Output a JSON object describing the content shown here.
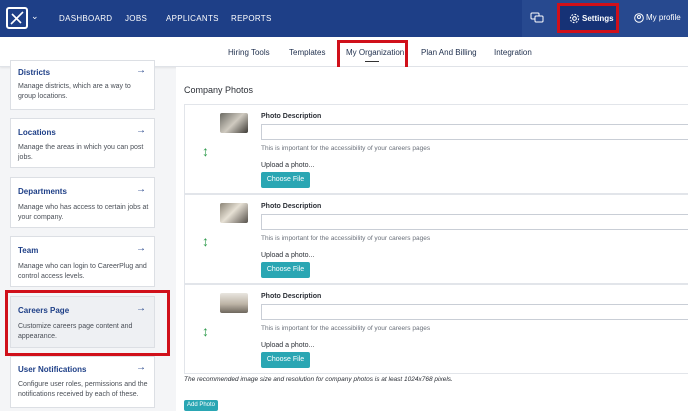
{
  "top_nav": {
    "items": [
      "DASHBOARD",
      "JOBS",
      "APPLICANTS",
      "REPORTS"
    ],
    "settings_label": "Settings",
    "profile_label": "My profile"
  },
  "sub_nav": {
    "items": [
      "Hiring Tools",
      "Templates",
      "My Organization",
      "Plan And Billing",
      "Integration"
    ],
    "active": "My Organization"
  },
  "sidebar": {
    "cards": [
      {
        "title": "Districts",
        "desc": "Manage districts, which are a way to group locations."
      },
      {
        "title": "Locations",
        "desc": "Manage the areas in which you can post jobs."
      },
      {
        "title": "Departments",
        "desc": "Manage who has access to certain jobs at your company."
      },
      {
        "title": "Team",
        "desc": "Manage who can login to CareerPlug and control access levels."
      },
      {
        "title": "Careers Page",
        "desc": "Customize careers page content and appearance."
      },
      {
        "title": "User Notifications",
        "desc": "Configure user roles, permissions and the notifications received by each of these."
      }
    ],
    "arrow_glyph": "→"
  },
  "main": {
    "section_title": "Company Photos",
    "photo_rows": [
      {
        "label": "Photo Description",
        "help": "This is important for the accessibility of your careers pages",
        "upload_label": "Upload a photo...",
        "button": "Choose File"
      },
      {
        "label": "Photo Description",
        "help": "This is important for the accessibility of your careers pages",
        "upload_label": "Upload a photo...",
        "button": "Choose File"
      },
      {
        "label": "Photo Description",
        "help": "This is important for the accessibility of your careers pages",
        "upload_label": "Upload a photo...",
        "button": "Choose File"
      }
    ],
    "footnote": "The recommended image size and resolution for company photos is at least 1024x768 pixels.",
    "add_photo": "Add Photo"
  },
  "colors": {
    "nav_bg": "#1e3f87",
    "accent_teal": "#2aa6b3",
    "highlight_red": "#d0101a",
    "drag_green": "#2e9b4c"
  }
}
